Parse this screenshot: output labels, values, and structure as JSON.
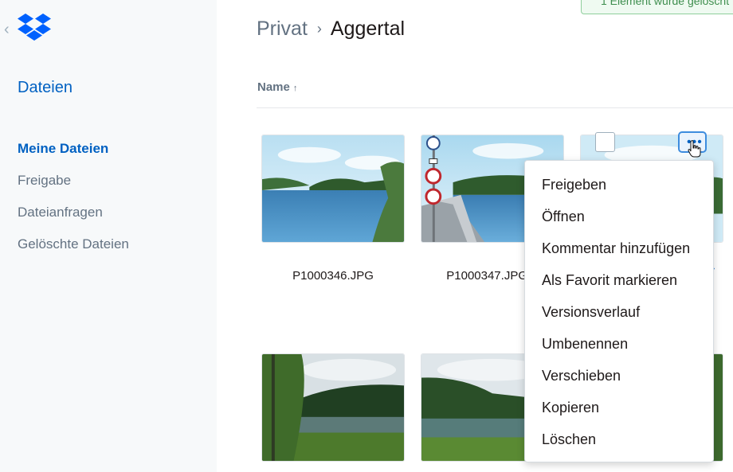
{
  "sidebar": {
    "back_icon": "chevron-left-icon",
    "logo_icon": "dropbox-logo-icon",
    "section_title": "Dateien",
    "items": [
      {
        "label": "Meine Dateien",
        "active": true
      },
      {
        "label": "Freigabe",
        "active": false
      },
      {
        "label": "Dateianfragen",
        "active": false
      },
      {
        "label": "Gelöschte Dateien",
        "active": false
      }
    ]
  },
  "breadcrumb": {
    "parent": "Privat",
    "separator": "›",
    "current": "Aggertal"
  },
  "toast": {
    "text": "1 Element wurde gelöscht"
  },
  "list_header": {
    "name_label": "Name",
    "sort_icon": "arrow-up-icon"
  },
  "files": [
    {
      "name": "P1000346.JPG"
    },
    {
      "name": "P1000347.JPG"
    }
  ],
  "context_menu": {
    "items": [
      {
        "label": "Freigeben"
      },
      {
        "label": "Öffnen"
      },
      {
        "label": "Kommentar hinzufügen"
      },
      {
        "label": "Als Favorit markieren"
      },
      {
        "label": "Versionsverlauf"
      },
      {
        "label": "Umbenennen"
      },
      {
        "label": "Verschieben"
      },
      {
        "label": "Kopieren"
      },
      {
        "label": "Löschen"
      }
    ]
  },
  "colors": {
    "accent": "#0061c2",
    "sidebar_bg": "#f7f9fa",
    "muted_text": "#637282"
  }
}
